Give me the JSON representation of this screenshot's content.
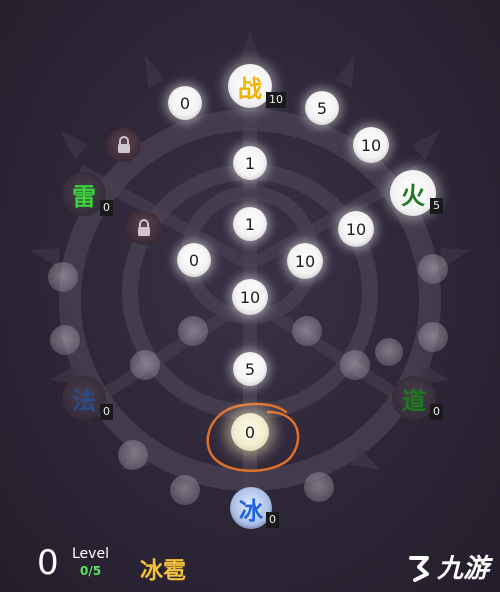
{
  "colors": {
    "background": "#2b2435",
    "ring": "#4a4154",
    "selection_circle": "#e0702a",
    "level_progress": "#5ee35e",
    "skill_name": "#f2c23a",
    "element_zhan": "#f0b400",
    "element_huo": "#1c7a1c",
    "element_lei": "#3ad43a",
    "element_fa": "#2a4a8a",
    "element_dao": "#1c7a1c",
    "element_bing": "#1f63e0"
  },
  "elements": [
    {
      "id": "zhan",
      "label": "战",
      "count": "10"
    },
    {
      "id": "huo",
      "label": "火",
      "count": "5"
    },
    {
      "id": "lei",
      "label": "雷",
      "count": "0"
    },
    {
      "id": "fa",
      "label": "法",
      "count": "0"
    },
    {
      "id": "dao",
      "label": "道",
      "count": "0"
    },
    {
      "id": "bing",
      "label": "冰",
      "count": "0"
    }
  ],
  "nodes": [
    {
      "id": "n1",
      "value": "0"
    },
    {
      "id": "n2",
      "value": "5"
    },
    {
      "id": "n3",
      "value": "10"
    },
    {
      "id": "n4",
      "value": "1"
    },
    {
      "id": "n5",
      "value": "10"
    },
    {
      "id": "n6",
      "value": "1"
    },
    {
      "id": "n7",
      "value": "0"
    },
    {
      "id": "n8",
      "value": "10"
    },
    {
      "id": "n9",
      "value": "10"
    },
    {
      "id": "n10",
      "value": "5"
    },
    {
      "id": "n11",
      "value": "0"
    }
  ],
  "locked_icon": "lock-icon",
  "hud": {
    "points": "0",
    "level_label": "Level",
    "level_progress": "0/5",
    "skill_name": "冰雹"
  },
  "watermark": {
    "text": "九游",
    "icon": "jiuyou-logo-icon"
  }
}
